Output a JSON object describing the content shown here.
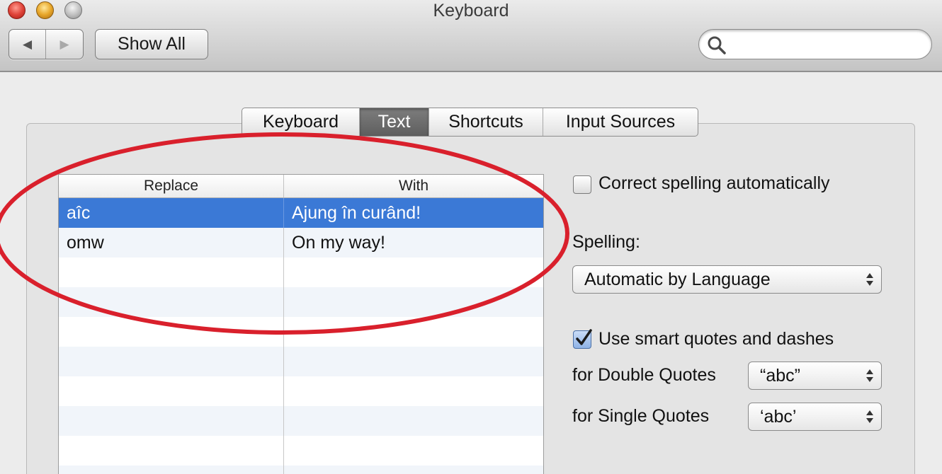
{
  "window": {
    "title": "Keyboard",
    "show_all_label": "Show All",
    "back_glyph": "◀",
    "forward_glyph": "▶",
    "search_placeholder": ""
  },
  "tabs": [
    {
      "label": "Keyboard",
      "selected": false
    },
    {
      "label": "Text",
      "selected": true
    },
    {
      "label": "Shortcuts",
      "selected": false
    },
    {
      "label": "Input Sources",
      "selected": false
    }
  ],
  "replacements": {
    "columns": [
      "Replace",
      "With"
    ],
    "rows": [
      {
        "replace": "aîc",
        "with": "Ajung în curând!",
        "selected": true
      },
      {
        "replace": "omw",
        "with": "On my way!",
        "selected": false
      }
    ]
  },
  "options": {
    "correct_spelling": {
      "label": "Correct spelling automatically",
      "checked": false
    },
    "spelling_label": "Spelling:",
    "spelling_value": "Automatic by Language",
    "smart_quotes": {
      "label": "Use smart quotes and dashes",
      "checked": true
    },
    "double_quotes_label": "for Double Quotes",
    "double_quotes_value": "“abc”",
    "single_quotes_label": "for Single Quotes",
    "single_quotes_value": "‘abc’"
  },
  "colors": {
    "selection": "#3b79d6",
    "annotation": "#d9202c"
  }
}
